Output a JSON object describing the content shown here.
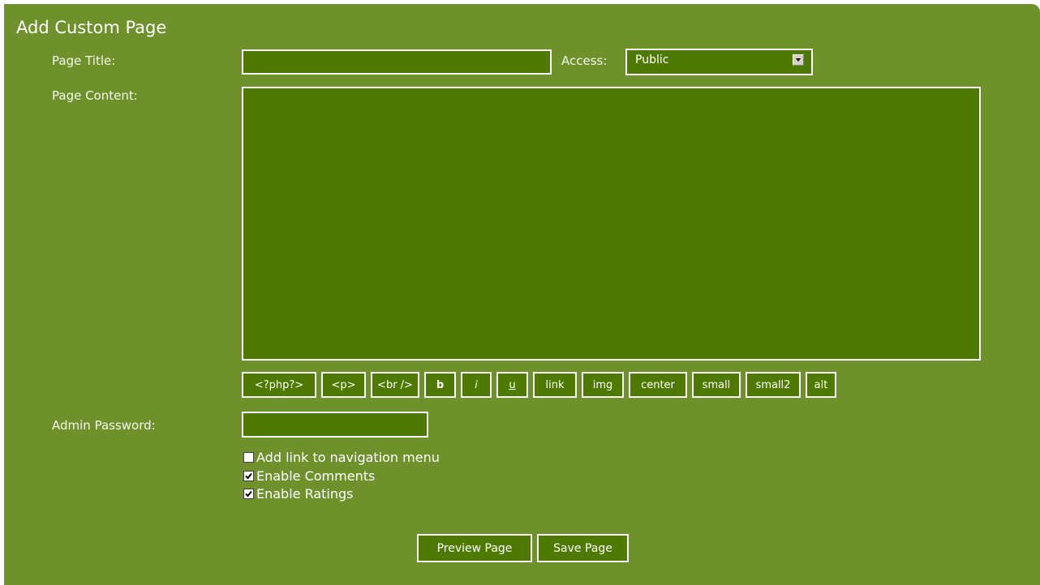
{
  "header": {
    "title": "Add Custom Page"
  },
  "form": {
    "page_title_label": "Page Title:",
    "page_title_value": "",
    "access_label": "Access:",
    "access_selected": "Public",
    "page_content_label": "Page Content:",
    "page_content_value": "",
    "admin_password_label": "Admin Password:",
    "admin_password_value": ""
  },
  "toolbar": {
    "php": "<?php?>",
    "p": "<p>",
    "br": "<br />",
    "b": "b",
    "i": "i",
    "u": "u",
    "link": "link",
    "img": "img",
    "center": "center",
    "small": "small",
    "small2": "small2",
    "alt": "alt"
  },
  "options": {
    "nav_link": {
      "label": "Add link to navigation menu",
      "checked": false
    },
    "comments": {
      "label": "Enable Comments",
      "checked": true
    },
    "ratings": {
      "label": "Enable Ratings",
      "checked": true
    }
  },
  "actions": {
    "preview": "Preview Page",
    "save": "Save Page"
  },
  "colors": {
    "panel": "#6e912c",
    "field": "#4f7a02",
    "border": "#ffffff"
  }
}
